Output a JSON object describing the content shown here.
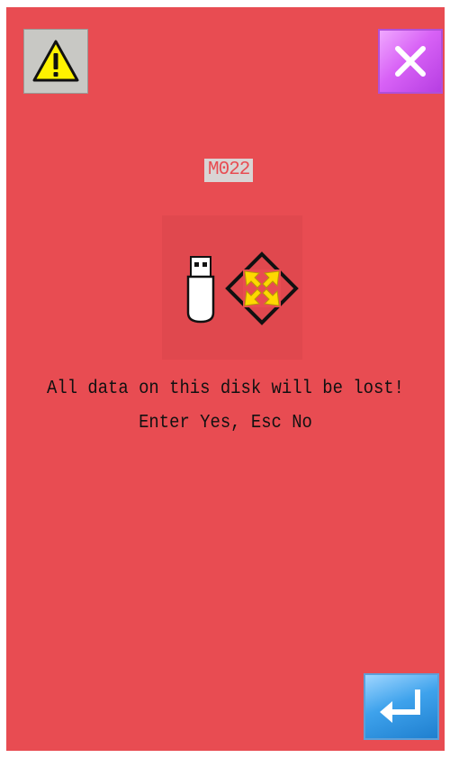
{
  "header": {
    "warning_icon": "warning-triangle-icon",
    "close_icon": "close-x-icon"
  },
  "dialog": {
    "code": "M022",
    "message_line1": "All data on this disk will be lost!",
    "message_line2": "Enter Yes, Esc No",
    "icons": [
      "usb-drive-icon",
      "move-arrows-icon"
    ]
  },
  "footer": {
    "enter_icon": "enter-return-icon"
  },
  "colors": {
    "background": "#e84c52",
    "close_button": "#d862f6",
    "enter_button": "#3ea2ec",
    "warning_button": "#c8c8c4"
  }
}
